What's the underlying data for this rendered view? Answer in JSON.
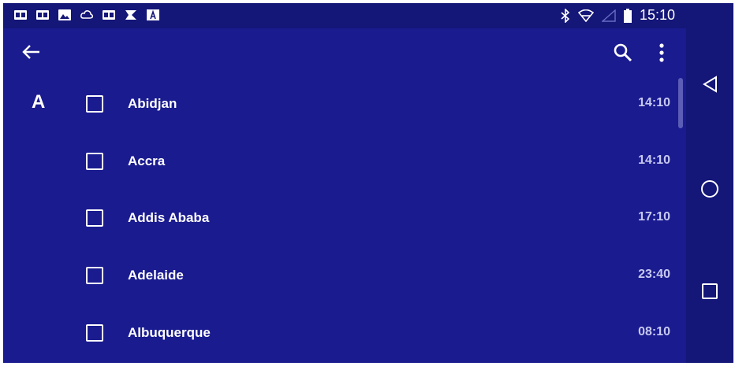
{
  "status_bar": {
    "time": "15:10",
    "left_icons": [
      "outlook-icon",
      "outlook-icon",
      "image-icon",
      "cloud-icon",
      "outlook-icon",
      "flag-icon",
      "font-icon"
    ],
    "right_icons": [
      "bluetooth-icon",
      "wifi-icon",
      "signal-icon",
      "battery-icon"
    ]
  },
  "toolbar": {
    "back_icon": "arrow-back-icon",
    "search_icon": "search-icon",
    "more_icon": "more-vert-icon"
  },
  "list": {
    "section_letter": "A",
    "items": [
      {
        "city": "Abidjan",
        "time": "14:10",
        "checked": false
      },
      {
        "city": "Accra",
        "time": "14:10",
        "checked": false
      },
      {
        "city": "Addis Ababa",
        "time": "17:10",
        "checked": false
      },
      {
        "city": "Adelaide",
        "time": "23:40",
        "checked": false
      },
      {
        "city": "Albuquerque",
        "time": "08:10",
        "checked": false
      }
    ]
  },
  "nav_bar": {
    "buttons": [
      "nav-back-icon",
      "nav-home-icon",
      "nav-recents-icon"
    ]
  },
  "colors": {
    "background": "#1a1b8f",
    "status_bar": "#141678",
    "time_text": "#c7c9f0"
  }
}
